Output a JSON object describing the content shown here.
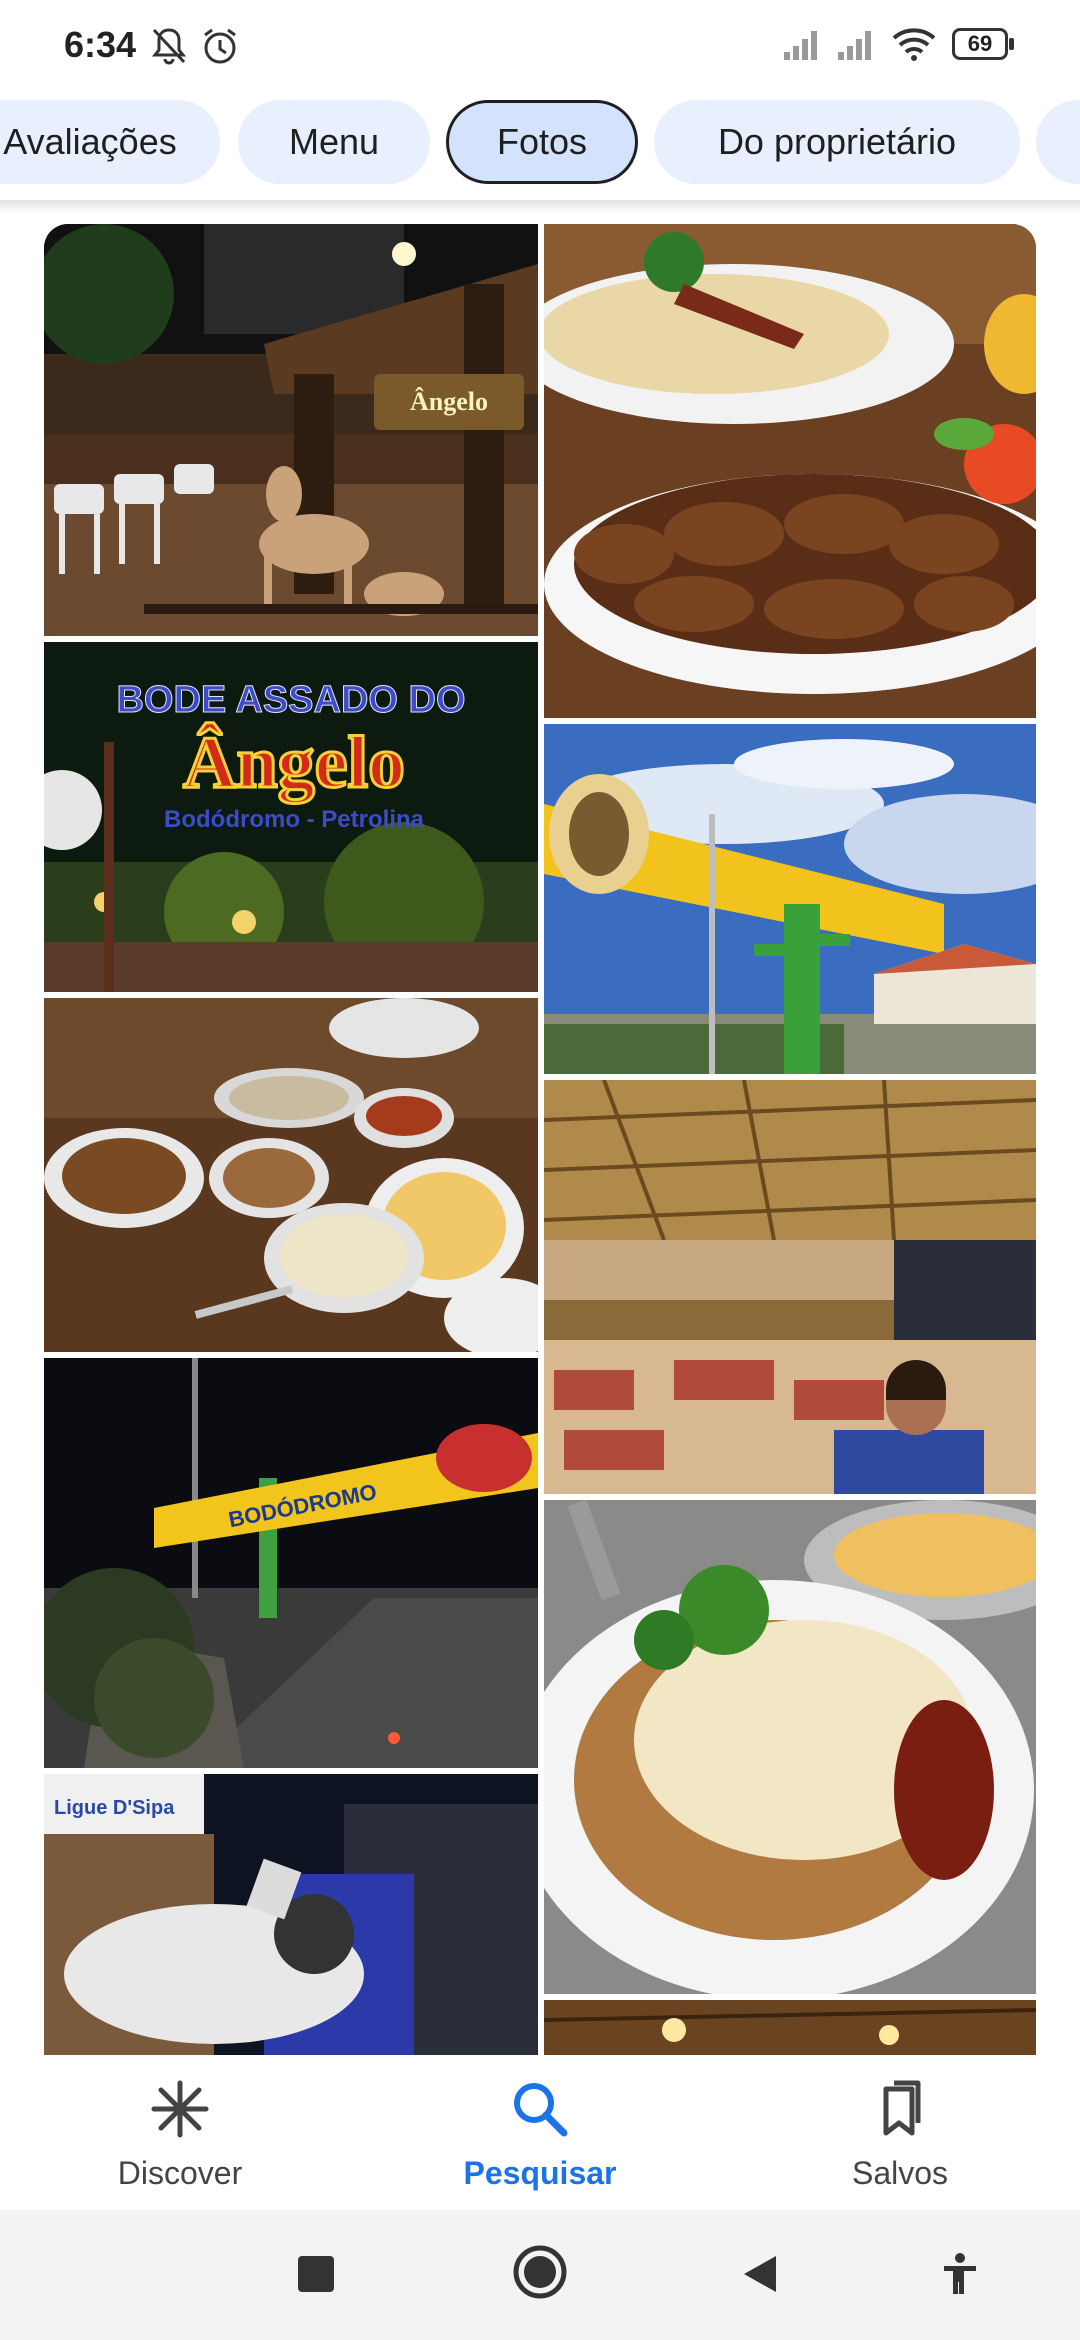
{
  "status_bar": {
    "time": "6:34",
    "battery": "69",
    "icons": [
      "bell-off-icon",
      "alarm-icon",
      "signal-icon",
      "signal-icon",
      "wifi-icon",
      "battery-icon"
    ]
  },
  "chips": [
    {
      "label": "Avaliações",
      "selected": false
    },
    {
      "label": "Menu",
      "selected": false
    },
    {
      "label": "Fotos",
      "selected": true
    },
    {
      "label": "Do proprietário",
      "selected": false
    }
  ],
  "photos": {
    "sign_logo_text": "BODE ASSADO DO",
    "sign_brand": "Ângelo",
    "sign_sub": "Bodódromo - Petrolina",
    "mini_sign": "Ângelo",
    "arch_text": "BODÓDROMO",
    "storefront_sign": "Ligue D'Sipa"
  },
  "bottom_nav": {
    "items": [
      {
        "label": "Discover",
        "icon": "asterisk-icon",
        "active": false
      },
      {
        "label": "Pesquisar",
        "icon": "search-icon",
        "active": true
      },
      {
        "label": "Salvos",
        "icon": "bookmarks-icon",
        "active": false
      }
    ]
  },
  "colors": {
    "accent": "#1a73e8",
    "chip_bg": "#e8f0fe",
    "chip_selected_bg": "#d3e3fd"
  }
}
